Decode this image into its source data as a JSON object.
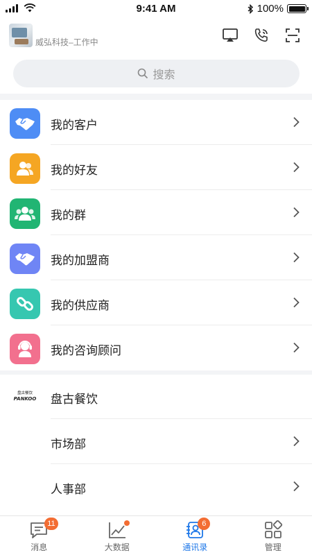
{
  "status_bar": {
    "time": "9:41 AM",
    "battery": "100%"
  },
  "header": {
    "status": "威弘科技–工作中"
  },
  "search": {
    "placeholder": "搜索"
  },
  "contacts": [
    {
      "label": "我的客户",
      "icon": "handshake-icon",
      "color": "#4e8df5"
    },
    {
      "label": "我的好友",
      "icon": "friends-icon",
      "color": "#f5a623"
    },
    {
      "label": "我的群",
      "icon": "group-icon",
      "color": "#21b573"
    },
    {
      "label": "我的加盟商",
      "icon": "handshake-icon",
      "color": "#6f85f5"
    },
    {
      "label": "我的供应商",
      "icon": "link-icon",
      "color": "#36c7b0"
    },
    {
      "label": "我的咨询顾问",
      "icon": "headset-icon",
      "color": "#f2708e"
    }
  ],
  "company": {
    "name": "盘古餐饮",
    "logo_text": "盘古餐饮",
    "logo_brand": "PANKOO",
    "departments": [
      "市场部",
      "人事部"
    ]
  },
  "tabs": [
    {
      "label": "消息",
      "icon": "message-icon",
      "badge": "11"
    },
    {
      "label": "大数据",
      "icon": "chart-icon",
      "dot": true
    },
    {
      "label": "通讯录",
      "icon": "contacts-icon",
      "badge": "6",
      "active": true
    },
    {
      "label": "管理",
      "icon": "apps-icon"
    }
  ],
  "colors": {
    "accent": "#1f78e8",
    "badge": "#f36d33"
  }
}
